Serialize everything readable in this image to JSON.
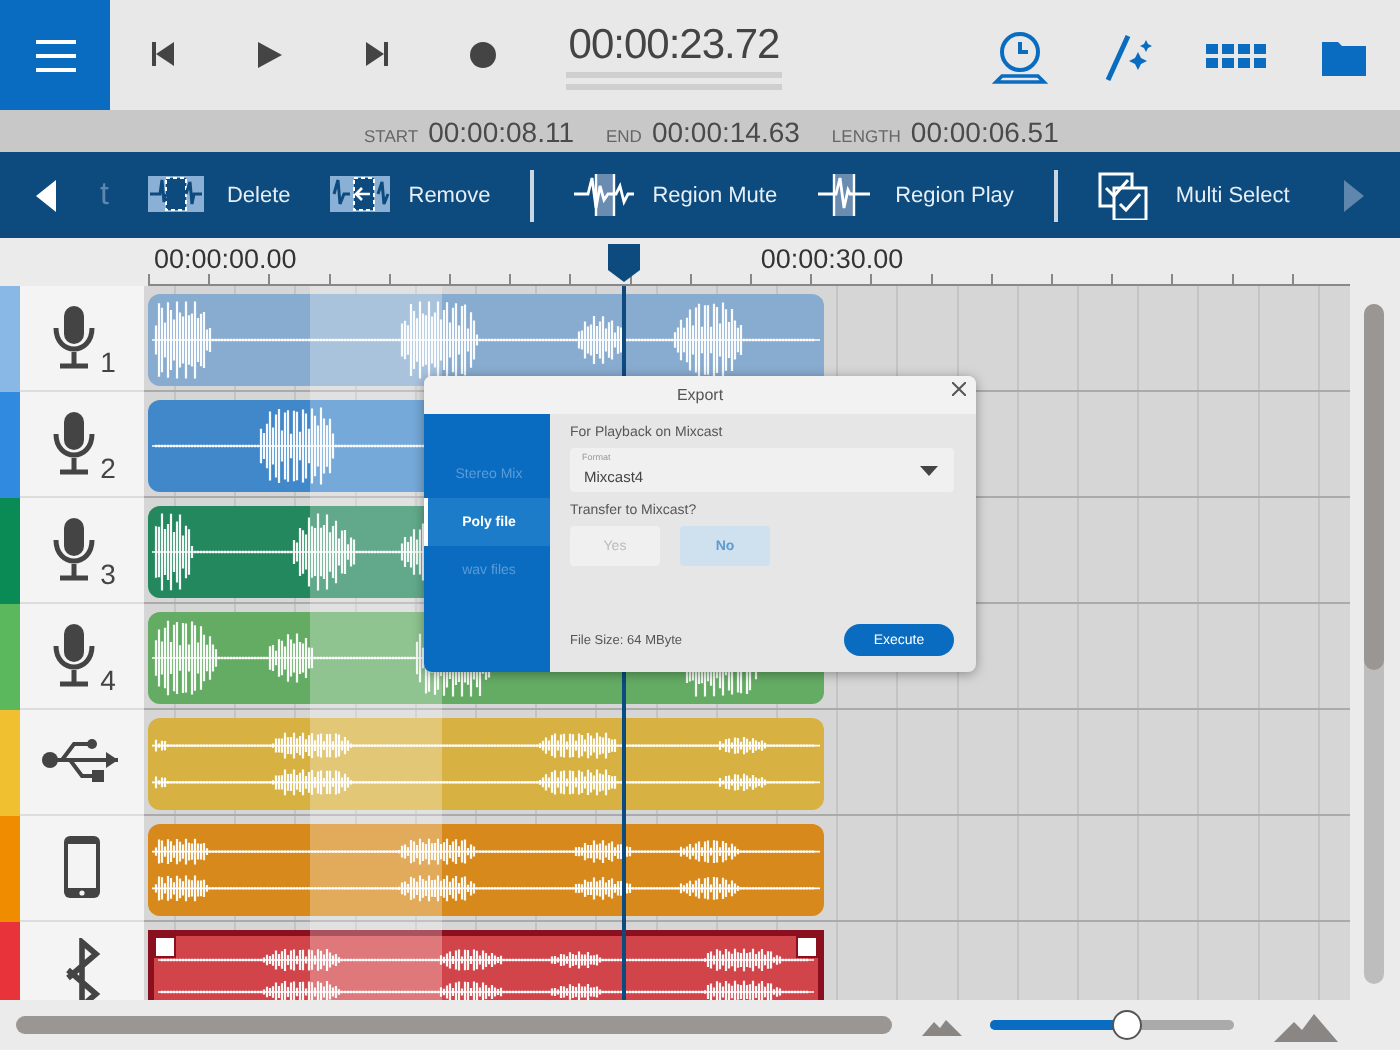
{
  "transport": {
    "time": "00:00:23.72"
  },
  "selection": [
    {
      "label": "START",
      "value": "00:00:08.11"
    },
    {
      "label": "END",
      "value": "00:00:14.63"
    },
    {
      "label": "LENGTH",
      "value": "00:00:06.51"
    }
  ],
  "toolbar": {
    "scroll_left": {
      "disabled": false
    },
    "scroll_right": {
      "disabled": true
    },
    "groups": [
      [
        {
          "kind": "partial",
          "label": "t"
        },
        {
          "kind": "delete",
          "label": "Delete"
        },
        {
          "kind": "remove",
          "label": "Remove"
        }
      ],
      [
        {
          "kind": "region-mute",
          "label": "Region Mute"
        },
        {
          "kind": "region-play",
          "label": "Region Play"
        }
      ],
      [
        {
          "kind": "multi-select",
          "label": "Multi Select"
        }
      ]
    ]
  },
  "ruler": {
    "labels": [
      "00:00:00.00",
      "00:00:30.00"
    ]
  },
  "tracks": [
    {
      "kind": "mic",
      "number": "1",
      "color": "#8ab8e6",
      "selected": false
    },
    {
      "kind": "mic",
      "number": "2",
      "color": "#2f8ae0",
      "selected": false
    },
    {
      "kind": "mic",
      "number": "3",
      "color": "#0a8a55",
      "selected": false
    },
    {
      "kind": "mic",
      "number": "4",
      "color": "#5cb85c",
      "selected": false
    },
    {
      "kind": "usb",
      "color": "#f0c030",
      "selected": false
    },
    {
      "kind": "phone",
      "color": "#f08c00",
      "selected": false
    },
    {
      "kind": "bluetooth",
      "color": "#e8333a",
      "selected": true
    }
  ],
  "export_dialog": {
    "title": "Export",
    "tabs": [
      {
        "label": "Stereo Mix",
        "selected": false
      },
      {
        "label": "Poly file",
        "selected": true
      },
      {
        "label": "wav files",
        "selected": false
      }
    ],
    "heading": "For Playback on Mixcast",
    "format": {
      "label": "Format",
      "value": "Mixcast4"
    },
    "question": "Transfer to Mixcast?",
    "options": [
      {
        "label": "Yes",
        "selected": false
      },
      {
        "label": "No",
        "selected": true
      }
    ],
    "file_size": "File Size: 64 MByte",
    "execute": "Execute"
  },
  "zoom_slider": {
    "level": 0.56
  }
}
